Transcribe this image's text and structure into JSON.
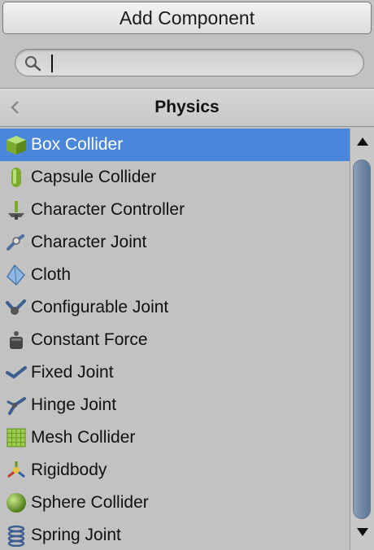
{
  "header": {
    "title": "Add Component"
  },
  "search": {
    "value": "",
    "placeholder": ""
  },
  "nav": {
    "back_icon": "chevron-left-icon",
    "title": "Physics"
  },
  "components": [
    {
      "label": "Box Collider",
      "icon": "box-collider-icon",
      "selected": true
    },
    {
      "label": "Capsule Collider",
      "icon": "capsule-collider-icon"
    },
    {
      "label": "Character Controller",
      "icon": "character-controller-icon"
    },
    {
      "label": "Character Joint",
      "icon": "character-joint-icon"
    },
    {
      "label": "Cloth",
      "icon": "cloth-icon"
    },
    {
      "label": "Configurable Joint",
      "icon": "configurable-joint-icon"
    },
    {
      "label": "Constant Force",
      "icon": "constant-force-icon"
    },
    {
      "label": "Fixed Joint",
      "icon": "fixed-joint-icon"
    },
    {
      "label": "Hinge Joint",
      "icon": "hinge-joint-icon"
    },
    {
      "label": "Mesh Collider",
      "icon": "mesh-collider-icon"
    },
    {
      "label": "Rigidbody",
      "icon": "rigidbody-icon"
    },
    {
      "label": "Sphere Collider",
      "icon": "sphere-collider-icon"
    },
    {
      "label": "Spring Joint",
      "icon": "spring-joint-icon"
    }
  ],
  "colors": {
    "selection": "#4a86d9",
    "background": "#c2c2c2",
    "icon_green": "#7cab2e"
  }
}
